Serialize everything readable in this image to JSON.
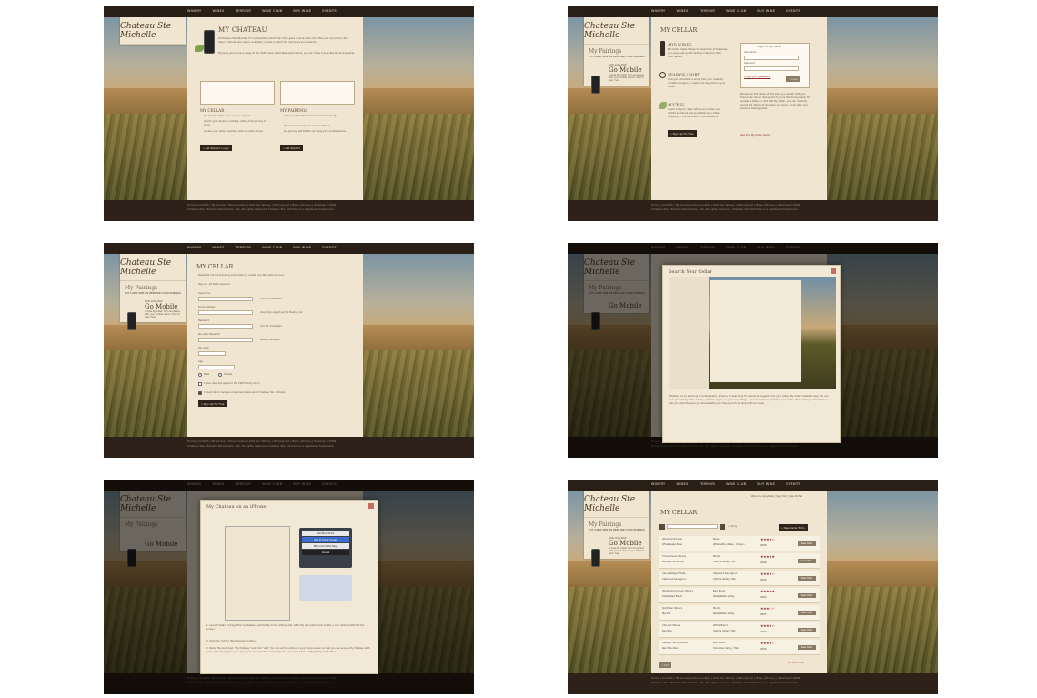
{
  "nav": [
    "WINERY",
    "WINES",
    "TERROIR",
    "WINE CLUB",
    "BUY WINE",
    "EVENTS"
  ],
  "logo": "Chateau Ste Michelle",
  "footer": "Home | Contact | Terms Use | Store Locator | Visit Our Winery | Mailing List | Press | Privacy | Sitemap\n©2009 Chateau Ste. Michelle Woodinville, WA. All rights reserved.\nChateau Ste. Michelle is a registered trademark.",
  "sidebar": {
    "pairings_title": "My Pairings",
    "pairings_sub": "PUT A NEW SPIN ON WINE AND FOOD PAIRINGS",
    "mobile_label": "NOW AVAILABLE",
    "mobile_title": "Go Mobile",
    "mobile_text": "Access My Cellar from anywhere with your mobile device. Click to learn how."
  },
  "screen1": {
    "title": "MY CHATEAU",
    "intro": "At Chateau Ste. Michelle, it's our heartfelt belief that a fine glass of wine does more than just round out a fine meal. It should also inspire, enlighten, inspire a visit to the memories you treasure.",
    "intro2": "Enjoying good wine is a way of life. With these useful New Applications, you can make it an entire life as enjoyable.",
    "cellar_title": "MY CELLAR",
    "cellar_items": [
      "Keep track of the wines you've enjoyed.",
      "Search your wines by vintage, rating, food pairing or more.",
      "Access your cellar anywhere with a mobile device."
    ],
    "pairings_title": "MY PAIRINGS",
    "pairings_items": [
      "Go beyond traditional food and wine pairings.",
      "Discover fresh ways to combine flavors.",
      "Let pairings set the fire up using your mobile device."
    ],
    "btn_cellar": "» Get Started / Login",
    "btn_pairings": "» Get Started"
  },
  "screen2": {
    "title": "MY CELLAR",
    "add_title": "ADD WINES",
    "add_text": "My Cellar makes it easy to keep track of the wines you enjoy, along with tasting notes and other vivid details.",
    "search_title": "SEARCH / SORT",
    "search_text": "Trying to remember a wine? Sort your cellar by varietal or region, or search for keywords in your notes.",
    "access_title": "ACCESS",
    "access_text": "Check out your cellar listings and notes over mobile anywhere and anywhere even while shopping in the store with a mobile device.",
    "signup_btn": "» Sign Up For Free",
    "login_title": "Login to My Cellar",
    "username_label": "Username",
    "password_label": "Password",
    "forgot": "Forgot your password?",
    "login_btn": "» Login",
    "promo_text": "Remember the name of that wine you shared with your friend over dinner last week? If you're like most people, the answer is likely no. Not with My Cellar, you can instantly record the details of any wine you enjoy, along with your personal tasting notes.",
    "promo_link": "See how My Cellar works"
  },
  "screen3": {
    "title": "MY CELLAR",
    "intro": "Please fill out the following information to create your My Cellar account.",
    "required": "Sign Up. All fields required",
    "fields": [
      "Username",
      "Email Address",
      "Password",
      "Re-enter Password",
      "Zip Code",
      "Age"
    ],
    "hints": [
      "4 to 12 characters",
      "Used only regarding the Mailing List",
      "4 to 12 characters",
      "Repeat password"
    ],
    "gender": [
      "Male",
      "Female"
    ],
    "agree": "I have read and agree to the CSM Privacy Policy",
    "optin": "I would like to receive occasional emails about Chateau Ste. Michelle",
    "signup_btn": "» Sign Up For Free"
  },
  "screen4": {
    "modal_title": "Search Your Cellar",
    "modal_text": "Whether you're planning a cocktail party, a menu, or searching for a wine to suggest from your cellar, My Cellar makes it easy. You can view your list by date, winery, varietal, region, or your own rating — or search for any words in your notes. Even if all you remember is that you liked the wine you shared with your friend, you'll be able to find it again."
  },
  "screen5": {
    "modal_title": "My Chateau on an iPhone",
    "sheet_items": [
      "Add Bookmark",
      "Add to Home Screen",
      "Mail Link to this Page",
      "Cancel"
    ],
    "steps": [
      "1. Launch Safari and type the mychateau.com/mobile to the address bar. After the site loads, click on the + icon at the bottom of the screen.",
      "2. Click the \"Add to Home Screen\" button.",
      "3. Name the bookmark \"My Chateau\" and click \"Add.\" An icon will be added to your home screen so that you can access My Chateau with just a click. Every time you visit, your can follow the same steps to access My Cellar or My Pairing application."
    ]
  },
  "screen6": {
    "title": "MY CELLAR",
    "welcome": "Welcome playtesta | Sign Out | View Profile",
    "list_by": "« list by",
    "new_entry_btn": "» New Cellar Entry",
    "rows": [
      {
        "name": "Woodward Creek",
        "sub": "Whale Lake Rose",
        "type": "Rose",
        "region": "Willamette Valley - Oregon",
        "vintage": "2008",
        "stars": "★★★★☆"
      },
      {
        "name": "Three Rivers Winery",
        "sub": "Runway Ultracade",
        "type": "Merlot",
        "region": "Yakima Valley / WA",
        "vintage": "2006",
        "stars": "★★★★★"
      },
      {
        "name": "Canoe Ridge Estate",
        "sub": "Cabernet Sauvignon",
        "type": "Cabernet Sauvignon",
        "region": "Yakima Valley / WA",
        "vintage": "2006",
        "stars": "★★★★☆"
      },
      {
        "name": "Woodward Canyon Winery",
        "sub": "Estate Red Blend",
        "type": "Red Blend",
        "region": "Walla Walla Valley",
        "vintage": "2005",
        "stars": "★★★★★"
      },
      {
        "name": "Northstar Winery",
        "sub": "Merlot",
        "type": "Merlot",
        "region": "Walla Walla Valley",
        "vintage": "2005",
        "stars": "★★★☆☆"
      },
      {
        "name": "Chinook Wines",
        "sub": "Semillon",
        "type": "White Blend",
        "region": "Yakima Valley / WA",
        "vintage": "2007",
        "stars": "★★★★☆"
      },
      {
        "name": "Hedges Family Estate",
        "sub": "Red Mountain",
        "type": "Red Blend",
        "region": "Columbia Valley / WA",
        "vintage": "2006",
        "stars": "★★★★☆"
      }
    ],
    "view_label": "View Wine",
    "pager": "1 2 3  View All",
    "add_btn": "» Add"
  }
}
